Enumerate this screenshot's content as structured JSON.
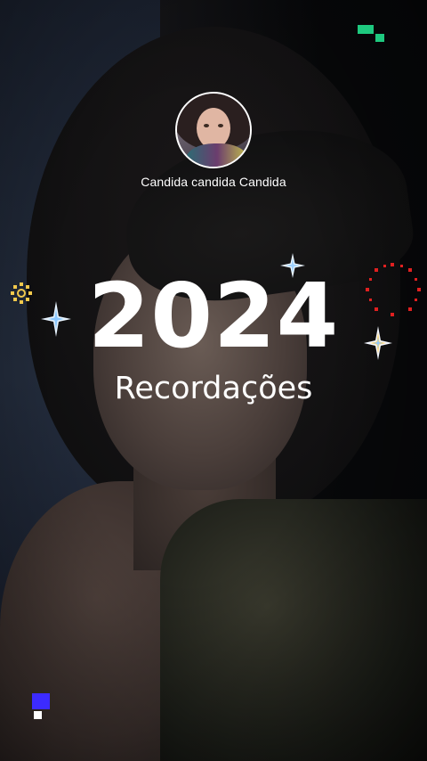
{
  "profile": {
    "username": "Candida candida Candida"
  },
  "headline": {
    "year": "2024",
    "subtitle": "Recordações"
  },
  "colors": {
    "text": "#ffffff",
    "sparkle": "#cfe9ff",
    "gold": "#f2c94c",
    "red_dots": "#e02020",
    "green_pixel": "#1ec97f",
    "blue_pixel": "#3c2bff"
  },
  "decorations": {
    "icons": [
      "sparkle-icon",
      "gold-ring-icon",
      "red-dot-ring-icon",
      "green-pixel-icon",
      "blue-pixel-icon"
    ]
  }
}
